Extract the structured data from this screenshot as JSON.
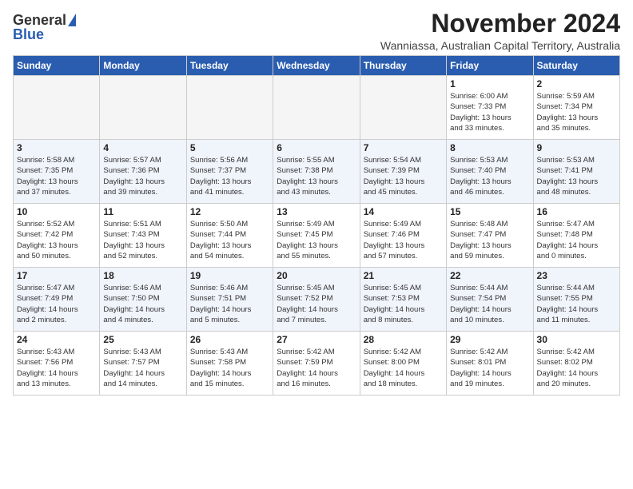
{
  "logo": {
    "general": "General",
    "blue": "Blue"
  },
  "title": "November 2024",
  "location": "Wanniassa, Australian Capital Territory, Australia",
  "headers": [
    "Sunday",
    "Monday",
    "Tuesday",
    "Wednesday",
    "Thursday",
    "Friday",
    "Saturday"
  ],
  "weeks": [
    [
      {
        "day": "",
        "info": ""
      },
      {
        "day": "",
        "info": ""
      },
      {
        "day": "",
        "info": ""
      },
      {
        "day": "",
        "info": ""
      },
      {
        "day": "",
        "info": ""
      },
      {
        "day": "1",
        "info": "Sunrise: 6:00 AM\nSunset: 7:33 PM\nDaylight: 13 hours\nand 33 minutes."
      },
      {
        "day": "2",
        "info": "Sunrise: 5:59 AM\nSunset: 7:34 PM\nDaylight: 13 hours\nand 35 minutes."
      }
    ],
    [
      {
        "day": "3",
        "info": "Sunrise: 5:58 AM\nSunset: 7:35 PM\nDaylight: 13 hours\nand 37 minutes."
      },
      {
        "day": "4",
        "info": "Sunrise: 5:57 AM\nSunset: 7:36 PM\nDaylight: 13 hours\nand 39 minutes."
      },
      {
        "day": "5",
        "info": "Sunrise: 5:56 AM\nSunset: 7:37 PM\nDaylight: 13 hours\nand 41 minutes."
      },
      {
        "day": "6",
        "info": "Sunrise: 5:55 AM\nSunset: 7:38 PM\nDaylight: 13 hours\nand 43 minutes."
      },
      {
        "day": "7",
        "info": "Sunrise: 5:54 AM\nSunset: 7:39 PM\nDaylight: 13 hours\nand 45 minutes."
      },
      {
        "day": "8",
        "info": "Sunrise: 5:53 AM\nSunset: 7:40 PM\nDaylight: 13 hours\nand 46 minutes."
      },
      {
        "day": "9",
        "info": "Sunrise: 5:53 AM\nSunset: 7:41 PM\nDaylight: 13 hours\nand 48 minutes."
      }
    ],
    [
      {
        "day": "10",
        "info": "Sunrise: 5:52 AM\nSunset: 7:42 PM\nDaylight: 13 hours\nand 50 minutes."
      },
      {
        "day": "11",
        "info": "Sunrise: 5:51 AM\nSunset: 7:43 PM\nDaylight: 13 hours\nand 52 minutes."
      },
      {
        "day": "12",
        "info": "Sunrise: 5:50 AM\nSunset: 7:44 PM\nDaylight: 13 hours\nand 54 minutes."
      },
      {
        "day": "13",
        "info": "Sunrise: 5:49 AM\nSunset: 7:45 PM\nDaylight: 13 hours\nand 55 minutes."
      },
      {
        "day": "14",
        "info": "Sunrise: 5:49 AM\nSunset: 7:46 PM\nDaylight: 13 hours\nand 57 minutes."
      },
      {
        "day": "15",
        "info": "Sunrise: 5:48 AM\nSunset: 7:47 PM\nDaylight: 13 hours\nand 59 minutes."
      },
      {
        "day": "16",
        "info": "Sunrise: 5:47 AM\nSunset: 7:48 PM\nDaylight: 14 hours\nand 0 minutes."
      }
    ],
    [
      {
        "day": "17",
        "info": "Sunrise: 5:47 AM\nSunset: 7:49 PM\nDaylight: 14 hours\nand 2 minutes."
      },
      {
        "day": "18",
        "info": "Sunrise: 5:46 AM\nSunset: 7:50 PM\nDaylight: 14 hours\nand 4 minutes."
      },
      {
        "day": "19",
        "info": "Sunrise: 5:46 AM\nSunset: 7:51 PM\nDaylight: 14 hours\nand 5 minutes."
      },
      {
        "day": "20",
        "info": "Sunrise: 5:45 AM\nSunset: 7:52 PM\nDaylight: 14 hours\nand 7 minutes."
      },
      {
        "day": "21",
        "info": "Sunrise: 5:45 AM\nSunset: 7:53 PM\nDaylight: 14 hours\nand 8 minutes."
      },
      {
        "day": "22",
        "info": "Sunrise: 5:44 AM\nSunset: 7:54 PM\nDaylight: 14 hours\nand 10 minutes."
      },
      {
        "day": "23",
        "info": "Sunrise: 5:44 AM\nSunset: 7:55 PM\nDaylight: 14 hours\nand 11 minutes."
      }
    ],
    [
      {
        "day": "24",
        "info": "Sunrise: 5:43 AM\nSunset: 7:56 PM\nDaylight: 14 hours\nand 13 minutes."
      },
      {
        "day": "25",
        "info": "Sunrise: 5:43 AM\nSunset: 7:57 PM\nDaylight: 14 hours\nand 14 minutes."
      },
      {
        "day": "26",
        "info": "Sunrise: 5:43 AM\nSunset: 7:58 PM\nDaylight: 14 hours\nand 15 minutes."
      },
      {
        "day": "27",
        "info": "Sunrise: 5:42 AM\nSunset: 7:59 PM\nDaylight: 14 hours\nand 16 minutes."
      },
      {
        "day": "28",
        "info": "Sunrise: 5:42 AM\nSunset: 8:00 PM\nDaylight: 14 hours\nand 18 minutes."
      },
      {
        "day": "29",
        "info": "Sunrise: 5:42 AM\nSunset: 8:01 PM\nDaylight: 14 hours\nand 19 minutes."
      },
      {
        "day": "30",
        "info": "Sunrise: 5:42 AM\nSunset: 8:02 PM\nDaylight: 14 hours\nand 20 minutes."
      }
    ]
  ]
}
